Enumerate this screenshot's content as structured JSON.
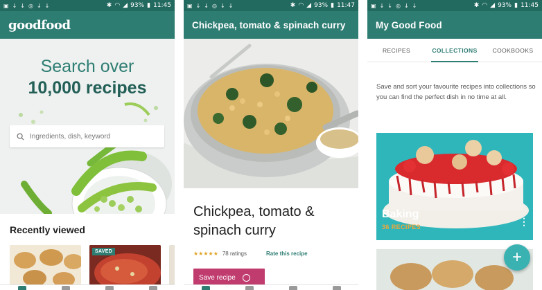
{
  "colors": {
    "statusbar": "#22695f",
    "appbar": "#2e7d73",
    "accent_teal": "#2e7d73",
    "save_button": "#c03b6e",
    "fab": "#3bb2b2",
    "recipes_count": "#f1a737",
    "stars": "#e0a326"
  },
  "phone1": {
    "status": {
      "battery": "93%",
      "time": "11:45"
    },
    "logo": "goodfood",
    "hero": {
      "line1": "Search over",
      "line2": "10,000 recipes"
    },
    "search": {
      "placeholder": "Ingredients, dish, keyword",
      "icon": "search-icon"
    },
    "recently_viewed": {
      "title": "Recently viewed",
      "items": [
        {
          "badge": ""
        },
        {
          "badge": "SAVED"
        }
      ]
    },
    "bottom_nav": [
      "home-icon",
      "collections-icon",
      "search-icon",
      "settings-icon"
    ]
  },
  "phone2": {
    "status": {
      "battery": "93%",
      "time": "11:47"
    },
    "title": "Chickpea, tomato & spinach curry",
    "recipe_title": "Chickpea, tomato & spinach curry",
    "rating": {
      "stars": 4,
      "stars_text": "★★★★★",
      "count": "78 ratings",
      "rate_link": "Rate this recipe"
    },
    "save_button": "Save recipe"
  },
  "phone3": {
    "status": {
      "battery": "93%",
      "time": "11:45"
    },
    "title": "My Good Food",
    "tabs": [
      "RECIPES",
      "COLLECTIONS",
      "COOKBOOKS"
    ],
    "active_tab": "COLLECTIONS",
    "intro": "Save and sort your favourite recipes into collections so you can find the perfect dish in no time at all.",
    "collection": {
      "name": "Baking",
      "count": "36 RECIPES",
      "more": "⋮"
    },
    "fab": "+"
  }
}
